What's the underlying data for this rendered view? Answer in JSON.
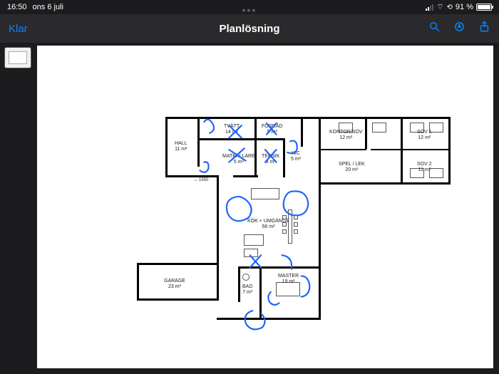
{
  "status": {
    "time": "16:50",
    "date": "ons 6 juli",
    "battery_pct": "91 %"
  },
  "toolbar": {
    "done": "Klar",
    "title": "Planlösning"
  },
  "rooms": {
    "hall": {
      "name": "HALL",
      "area": "11 m²"
    },
    "tvatt": {
      "name": "TVÄTT",
      "area": "14 m²"
    },
    "forrad": {
      "name": "FÖRRÅD",
      "area": "5 m²"
    },
    "kontor": {
      "name": "KONTOR/SOV",
      "area": "12 m²"
    },
    "sov1": {
      "name": "SOV 1",
      "area": "12 m²"
    },
    "matkallare": {
      "name": "MATKÄLLARE",
      "area": "5 m²"
    },
    "teknik": {
      "name": "TEKNIK",
      "area": "3 m²"
    },
    "wc": {
      "name": "WC",
      "area": "5 m²"
    },
    "spel": {
      "name": "SPEL / LEK",
      "area": "20 m²"
    },
    "sov2": {
      "name": "SOV 2",
      "area": "11 m²"
    },
    "kok": {
      "name": "KÖK + UMGÄNGE",
      "area": "56 m²"
    },
    "garage": {
      "name": "GARAGE",
      "area": "23 m²"
    },
    "bad": {
      "name": "BAD",
      "area": "7 m²"
    },
    "master": {
      "name": "MASTER",
      "area": "19 m²"
    }
  },
  "dims": {
    "d1550": "1550"
  }
}
